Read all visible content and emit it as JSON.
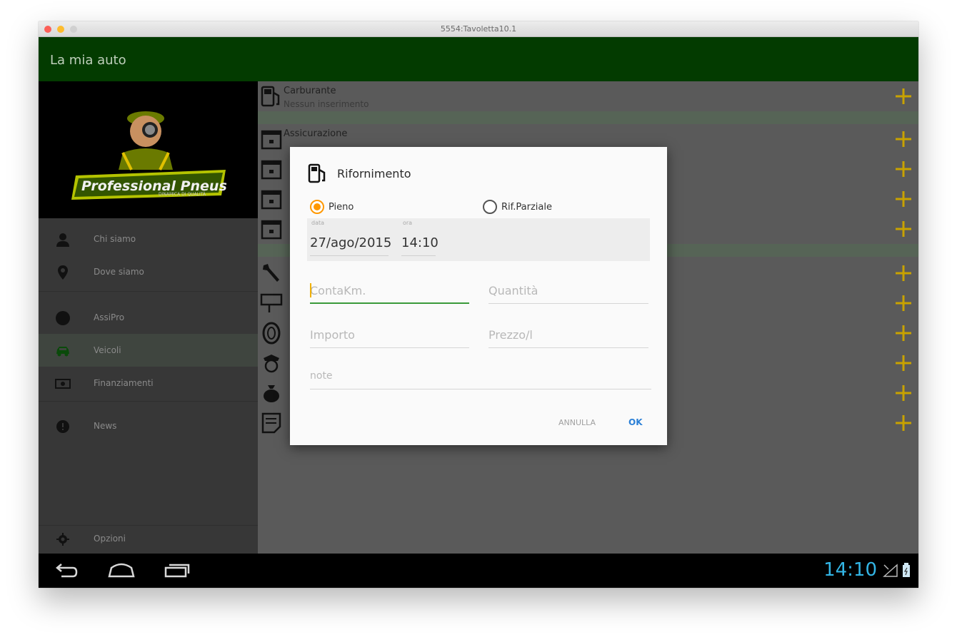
{
  "window": {
    "title": "5554:Tavoletta10.1"
  },
  "appbar": {
    "title": "La mia auto"
  },
  "logo": {
    "brand": "Professional Pneus",
    "tagline": "DINAMICA DI QUALITÀ"
  },
  "drawer": {
    "items": [
      {
        "label": "Chi siamo",
        "icon": "person-icon"
      },
      {
        "label": "Dove siamo",
        "icon": "location-pin-icon"
      },
      {
        "label": "AssiPro",
        "icon": "circle-icon"
      },
      {
        "label": "Veicoli",
        "icon": "car-icon"
      },
      {
        "label": "Finanziamenti",
        "icon": "money-icon"
      },
      {
        "label": "News",
        "icon": "info-icon"
      },
      {
        "label": "Opzioni",
        "icon": "gear-icon"
      }
    ]
  },
  "list": {
    "fuel": {
      "title": "Carburante",
      "subtitle": "Nessun inserimento"
    },
    "insurance": {
      "title": "Assicurazione"
    }
  },
  "dialog": {
    "title": "Rifornimento",
    "radio_full": "Pieno",
    "radio_partial": "Rif.Parziale",
    "date_label": "data",
    "time_label": "ora",
    "date_value": "27/ago/2015",
    "time_value": "14:10",
    "placeholder_km": "ContaKm.",
    "placeholder_qty": "Quantità",
    "placeholder_amount": "Importo",
    "placeholder_price": "Prezzo/l",
    "placeholder_notes": "note",
    "cancel_label": "ANNULLA",
    "ok_label": "OK"
  },
  "statusbar": {
    "time": "14:10"
  },
  "colors": {
    "appbar": "#033b00",
    "accent": "#ff9800",
    "clock": "#33b5e5",
    "plus": "#c8a200"
  }
}
